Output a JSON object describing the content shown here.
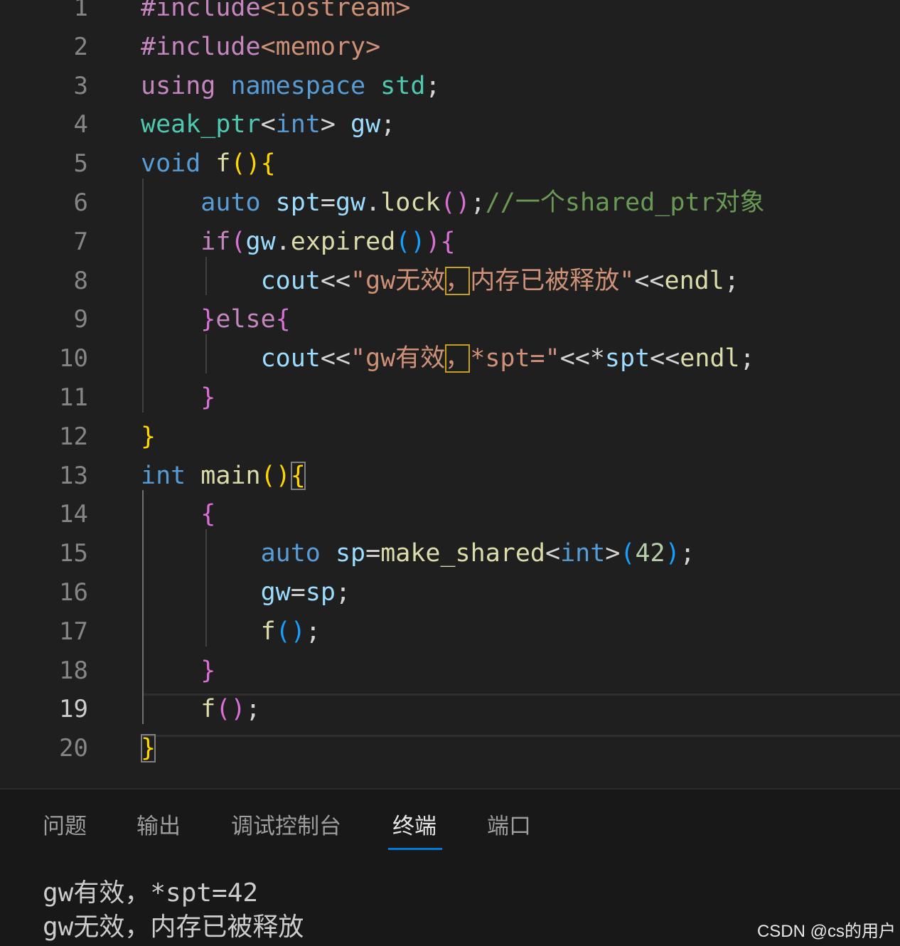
{
  "editor": {
    "active_line": 19,
    "line_numbers": [
      "1",
      "2",
      "3",
      "4",
      "5",
      "6",
      "7",
      "8",
      "9",
      "10",
      "11",
      "12",
      "13",
      "14",
      "15",
      "16",
      "17",
      "18",
      "19",
      "20"
    ],
    "lines": [
      [
        [
          "#include",
          "inc"
        ],
        [
          "<iostream>",
          "str"
        ]
      ],
      [
        [
          "#include",
          "inc"
        ],
        [
          "<memory>",
          "str"
        ]
      ],
      [
        [
          "using",
          "ctl"
        ],
        [
          " ",
          "pl"
        ],
        [
          "namespace",
          "kw"
        ],
        [
          " ",
          "pl"
        ],
        [
          "std",
          "type"
        ],
        [
          ";",
          "pl"
        ]
      ],
      [
        [
          "weak_ptr",
          "type"
        ],
        [
          "<",
          "pl"
        ],
        [
          "int",
          "kw"
        ],
        [
          "> ",
          "pl"
        ],
        [
          "gw",
          "var"
        ],
        [
          ";",
          "pl"
        ]
      ],
      [
        [
          "void",
          "kw"
        ],
        [
          " ",
          "pl"
        ],
        [
          "f",
          "fn"
        ],
        [
          "()",
          "b1"
        ],
        [
          "{",
          "b1"
        ]
      ],
      [
        [
          "    ",
          "pl"
        ],
        [
          "auto",
          "kw"
        ],
        [
          " ",
          "pl"
        ],
        [
          "spt",
          "var"
        ],
        [
          "=",
          "pl"
        ],
        [
          "gw",
          "var"
        ],
        [
          ".",
          "pl"
        ],
        [
          "lock",
          "fn"
        ],
        [
          "()",
          "b2"
        ],
        [
          ";",
          "pl"
        ],
        [
          "//一个shared_ptr对象",
          "com"
        ]
      ],
      [
        [
          "    ",
          "pl"
        ],
        [
          "if",
          "ctl"
        ],
        [
          "(",
          "b2"
        ],
        [
          "gw",
          "var"
        ],
        [
          ".",
          "pl"
        ],
        [
          "expired",
          "fn"
        ],
        [
          "()",
          "b3"
        ],
        [
          ")",
          "b2"
        ],
        [
          "{",
          "b2"
        ]
      ],
      [
        [
          "        ",
          "pl"
        ],
        [
          "cout",
          "var"
        ],
        [
          "<<",
          "pl"
        ],
        [
          "\"gw无效",
          "str"
        ],
        [
          "，",
          "str",
          "hlbox"
        ],
        [
          "内存已被释放\"",
          "str"
        ],
        [
          "<<",
          "pl"
        ],
        [
          "endl",
          "fn"
        ],
        [
          ";",
          "pl"
        ]
      ],
      [
        [
          "    ",
          "pl"
        ],
        [
          "}",
          "b2"
        ],
        [
          "else",
          "ctl"
        ],
        [
          "{",
          "b2"
        ]
      ],
      [
        [
          "        ",
          "pl"
        ],
        [
          "cout",
          "var"
        ],
        [
          "<<",
          "pl"
        ],
        [
          "\"gw有效",
          "str"
        ],
        [
          "，",
          "str",
          "hlbox"
        ],
        [
          "*spt=\"",
          "str"
        ],
        [
          "<<*",
          "pl"
        ],
        [
          "spt",
          "var"
        ],
        [
          "<<",
          "pl"
        ],
        [
          "endl",
          "fn"
        ],
        [
          ";",
          "pl"
        ]
      ],
      [
        [
          "    ",
          "pl"
        ],
        [
          "}",
          "b2"
        ]
      ],
      [
        [
          "}",
          "b1"
        ]
      ],
      [
        [
          "int",
          "kw"
        ],
        [
          " ",
          "pl"
        ],
        [
          "main",
          "fn"
        ],
        [
          "()",
          "b1"
        ],
        [
          "{",
          "b1",
          "brbox"
        ]
      ],
      [
        [
          "    ",
          "pl"
        ],
        [
          "{",
          "b2"
        ]
      ],
      [
        [
          "        ",
          "pl"
        ],
        [
          "auto",
          "kw"
        ],
        [
          " ",
          "pl"
        ],
        [
          "sp",
          "var"
        ],
        [
          "=",
          "pl"
        ],
        [
          "make_shared",
          "fn"
        ],
        [
          "<",
          "pl"
        ],
        [
          "int",
          "kw"
        ],
        [
          ">",
          "pl"
        ],
        [
          "(",
          "b3"
        ],
        [
          "42",
          "num"
        ],
        [
          ")",
          "b3"
        ],
        [
          ";",
          "pl"
        ]
      ],
      [
        [
          "        ",
          "pl"
        ],
        [
          "gw",
          "var"
        ],
        [
          "=",
          "pl"
        ],
        [
          "sp",
          "var"
        ],
        [
          ";",
          "pl"
        ]
      ],
      [
        [
          "        ",
          "pl"
        ],
        [
          "f",
          "fn"
        ],
        [
          "()",
          "b3"
        ],
        [
          ";",
          "pl"
        ]
      ],
      [
        [
          "    ",
          "pl"
        ],
        [
          "}",
          "b2"
        ]
      ],
      [
        [
          "    ",
          "pl"
        ],
        [
          "f",
          "fn"
        ],
        [
          "()",
          "b2"
        ],
        [
          ";",
          "pl"
        ]
      ],
      [
        [
          "}",
          "b1",
          "brbox"
        ]
      ]
    ]
  },
  "panel": {
    "tabs": [
      {
        "label": "问题",
        "name": "tab-problems",
        "active": false
      },
      {
        "label": "输出",
        "name": "tab-output",
        "active": false
      },
      {
        "label": "调试控制台",
        "name": "tab-debug-console",
        "active": false
      },
      {
        "label": "终端",
        "name": "tab-terminal",
        "active": true
      },
      {
        "label": "端口",
        "name": "tab-ports",
        "active": false
      }
    ],
    "terminal_output": [
      "gw有效，*spt=42",
      "gw无效，内存已被释放"
    ]
  },
  "watermark": "CSDN @cs的用户",
  "colors": {
    "background": "#1f1f1f",
    "panel_background": "#181818",
    "tab_accent": "#0078d4",
    "keyword": "#569cd6",
    "string": "#ce9178",
    "comment": "#6a9955",
    "type": "#4ec9b0",
    "variable": "#9cdcfe",
    "function": "#dcdcaa"
  }
}
